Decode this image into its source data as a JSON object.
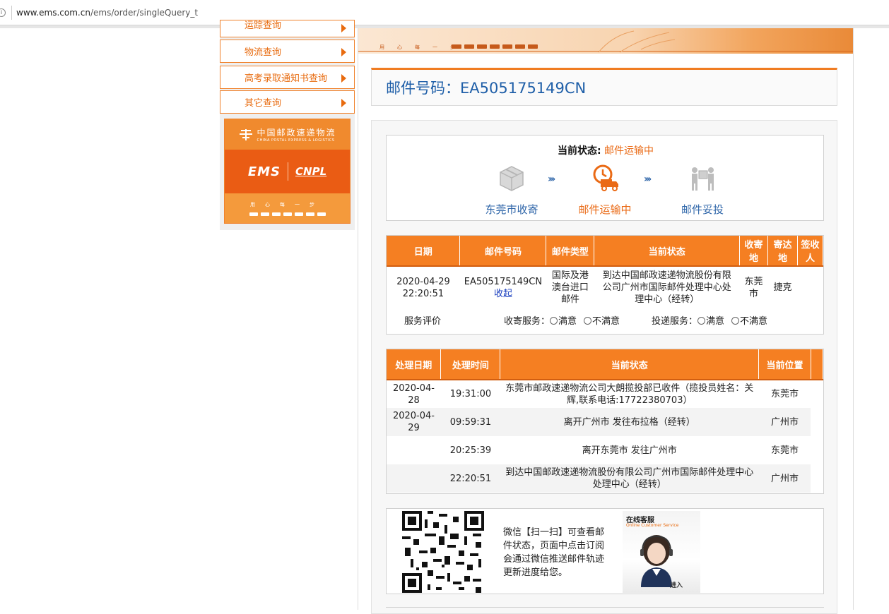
{
  "browser": {
    "url_host": "www.ems.com.cn",
    "url_path": "/ems/order/singleQuery_t"
  },
  "sidebar": {
    "items": [
      {
        "label": "运踪查询"
      },
      {
        "label": "物流查询"
      },
      {
        "label": "高考录取通知书查询"
      },
      {
        "label": "其它查询"
      }
    ],
    "banner": {
      "cn": "中国邮政速递物流",
      "en": "CHINA POSTAL EXPRESS & LOGISTICS",
      "ems": "EMS",
      "cnpl": "CNPL",
      "slogan": "用心每一步"
    }
  },
  "top_band": {
    "slogan": "用心每一步"
  },
  "mail_number": {
    "label": "邮件号码：",
    "value": "EA505175149CN"
  },
  "status": {
    "label": "当前状态:",
    "value": "邮件运输中",
    "stages": [
      {
        "name": "东莞市收寄",
        "icon": "package-icon"
      },
      {
        "name": "邮件运输中",
        "icon": "truck-clock-icon"
      },
      {
        "name": "邮件妥投",
        "icon": "delivery-person-icon"
      }
    ]
  },
  "summary_table": {
    "headers": [
      "日期",
      "邮件号码",
      "邮件类型",
      "当前状态",
      "收寄地",
      "寄达地",
      "签收人"
    ],
    "row": {
      "date": "2020-04-29 22:20:51",
      "number": "EA505175149CN",
      "collapse": "收起",
      "type": "国际及港澳台进口邮件",
      "status": "到达中国邮政速递物流股份有限公司广州市国际邮件处理中心处理中心（经转）",
      "origin": "东莞市",
      "destination": "捷克",
      "signer": ""
    },
    "evaluation": {
      "label": "服务评价",
      "collect_label": "收寄服务：",
      "deliver_label": "投递服务：",
      "satisfied": "满意",
      "unsatisfied": "不满意"
    }
  },
  "tracking_table": {
    "headers": [
      "处理日期",
      "处理时间",
      "当前状态",
      "当前位置"
    ],
    "rows": [
      {
        "date": "2020-04-28",
        "time": "19:31:00",
        "status": "东莞市邮政速递物流公司大朗揽投部已收件（揽投员姓名：关辉,联系电话:17722380703）",
        "location": "东莞市"
      },
      {
        "date": "2020-04-29",
        "time": "09:59:31",
        "status": "离开广州市 发往布拉格（经转）",
        "location": "广州市"
      },
      {
        "date": "",
        "time": "20:25:39",
        "status": "离开东莞市 发往广州市",
        "location": "东莞市"
      },
      {
        "date": "",
        "time": "22:20:51",
        "status": "到达中国邮政速递物流股份有限公司广州市国际邮件处理中心处理中心（经转）",
        "location": "广州市"
      }
    ]
  },
  "wechat": {
    "text": "微信【扫一扫】可查看邮件状态，页面中点击订阅会通过微信推送邮件轨迹更新进度给您。",
    "cs_title": "在线客服",
    "cs_subtitle": "Online Customer Service",
    "cs_enter": "进入"
  },
  "colors": {
    "accent": "#f57f22",
    "link": "#1f5fa8",
    "status": "#ea6a15"
  }
}
